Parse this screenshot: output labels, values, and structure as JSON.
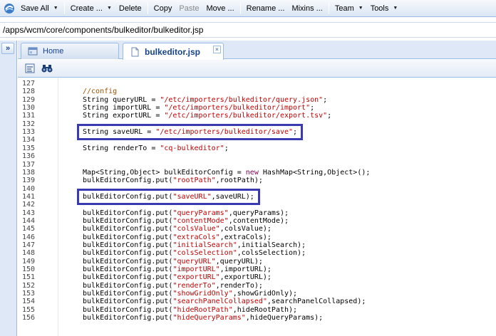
{
  "toolbar": {
    "items": [
      {
        "label": "Save All",
        "arrow": true
      },
      {
        "label": "Create ...",
        "arrow": true
      },
      {
        "label": "Delete"
      },
      {
        "label": "Copy"
      },
      {
        "label": "Paste",
        "disabled": true
      },
      {
        "label": "Move ..."
      },
      {
        "label": "Rename ..."
      },
      {
        "label": "Mixins ..."
      },
      {
        "label": "Team",
        "arrow": true
      },
      {
        "label": "Tools",
        "arrow": true
      }
    ]
  },
  "path": "/apps/wcm/core/components/bulkeditor/bulkeditor.jsp",
  "tabs": {
    "home": "Home",
    "active": "bulkeditor.jsp"
  },
  "expand_symbol": "»",
  "close_symbol": "×",
  "colors": {
    "highlight_box": "#3a3ab0",
    "comment": "#a05000",
    "string": "#c00000",
    "keyword": "#7f0055"
  },
  "code_lines": [
    {
      "n": "127",
      "code": ""
    },
    {
      "n": "128",
      "code": "//config"
    },
    {
      "n": "129",
      "code": "String queryURL = \"/etc/importers/bulkeditor/query.json\";"
    },
    {
      "n": "130",
      "code": "String importURL = \"/etc/importers/bulkeditor/import\";"
    },
    {
      "n": "131",
      "code": "String exportURL = \"/etc/importers/bulkeditor/export.tsv\";"
    },
    {
      "n": "132",
      "code": ""
    },
    {
      "n": "133",
      "code": "String saveURL = \"/etc/importers/bulkeditor/save\";"
    },
    {
      "n": "134",
      "code": ""
    },
    {
      "n": "135",
      "code": "String renderTo = \"cq-bulkeditor\";"
    },
    {
      "n": "136",
      "code": ""
    },
    {
      "n": "137",
      "code": ""
    },
    {
      "n": "138",
      "code": "Map<String,Object> bulkEditorConfig = new HashMap<String,Object>();"
    },
    {
      "n": "139",
      "code": "bulkEditorConfig.put(\"rootPath\",rootPath);"
    },
    {
      "n": "140",
      "code": ""
    },
    {
      "n": "141",
      "code": "bulkEditorConfig.put(\"saveURL\",saveURL);"
    },
    {
      "n": "142",
      "code": ""
    },
    {
      "n": "143",
      "code": "bulkEditorConfig.put(\"queryParams\",queryParams);"
    },
    {
      "n": "144",
      "code": "bulkEditorConfig.put(\"contentMode\",contentMode);"
    },
    {
      "n": "145",
      "code": "bulkEditorConfig.put(\"colsValue\",colsValue);"
    },
    {
      "n": "146",
      "code": "bulkEditorConfig.put(\"extraCols\",extraCols);"
    },
    {
      "n": "147",
      "code": "bulkEditorConfig.put(\"initialSearch\",initialSearch);"
    },
    {
      "n": "148",
      "code": "bulkEditorConfig.put(\"colsSelection\",colsSelection);"
    },
    {
      "n": "149",
      "code": "bulkEditorConfig.put(\"queryURL\",queryURL);"
    },
    {
      "n": "150",
      "code": "bulkEditorConfig.put(\"importURL\",importURL);"
    },
    {
      "n": "151",
      "code": "bulkEditorConfig.put(\"exportURL\",exportURL);"
    },
    {
      "n": "152",
      "code": "bulkEditorConfig.put(\"renderTo\",renderTo);"
    },
    {
      "n": "153",
      "code": "bulkEditorConfig.put(\"showGridOnly\",showGridOnly);"
    },
    {
      "n": "154",
      "code": "bulkEditorConfig.put(\"searchPanelCollapsed\",searchPanelCollapsed);"
    },
    {
      "n": "155",
      "code": "bulkEditorConfig.put(\"hideRootPath\",hideRootPath);"
    },
    {
      "n": "156",
      "code": "bulkEditorConfig.put(\"hideQueryParams\",hideQueryParams);"
    }
  ],
  "highlighted_lines": [
    "133",
    "141"
  ]
}
